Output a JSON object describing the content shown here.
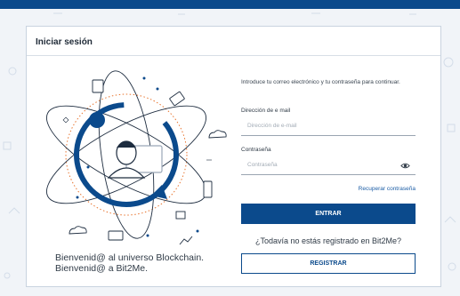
{
  "header": {
    "title": "Iniciar sesión"
  },
  "welcome": {
    "line1": "Bienvenid@ al universo Blockchain.",
    "line2": "Bienvenid@ a Bit2Me."
  },
  "form": {
    "intro": "Introduce tu correo electrónico y tu contraseña para continuar.",
    "email_label": "Dirección de e mail",
    "email_placeholder": "Dirección de e-mail",
    "password_label": "Contraseña",
    "password_placeholder": "Contraseña",
    "recover_link": "Recuperar contraseña",
    "submit_label": "ENTRAR",
    "register_question": "¿Todavía no estás registrado en Bit2Me?",
    "register_label": "REGISTRAR"
  },
  "icons": {
    "show_password": "eye-icon",
    "illustration": "blockchain-user-icon"
  },
  "colors": {
    "brand": "#0b4a8c",
    "link": "#1d5ea6",
    "accent_dotted": "#e8742e"
  }
}
